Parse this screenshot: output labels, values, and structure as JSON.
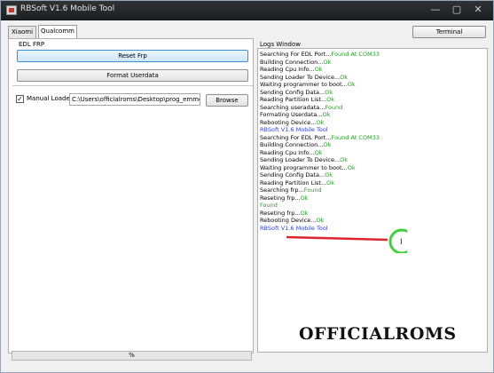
{
  "window": {
    "title": "RBSoft V1.6 Mobile Tool",
    "controls": {
      "minimize": "—",
      "maximize": "▢",
      "close": "✕"
    }
  },
  "tabs": [
    {
      "label": "Xiaomi",
      "selected": false
    },
    {
      "label": "Qualcomm",
      "selected": true
    }
  ],
  "terminal_label": "Terminal",
  "edl": {
    "group_label": "EDL FRP",
    "reset_label": "Reset Frp",
    "format_label": "Format Userdata"
  },
  "loader": {
    "checkbox_label": "Manual Loader",
    "checked": true,
    "path_value": "C:\\Users\\officialroms\\Desktop\\prog_emmc_fi",
    "browse_label": "Browse"
  },
  "logs": {
    "label": "Logs Window",
    "lines": [
      {
        "text": "Searching For EDL Port...",
        "suffix": "Found At COM33",
        "color": "green"
      },
      {
        "text": "Building Connection...",
        "suffix": "Ok",
        "color": "green"
      },
      {
        "text": "Reading Cpu Info...",
        "suffix": "Ok",
        "color": "green"
      },
      {
        "text": "Sending Loader To Device...",
        "suffix": "Ok",
        "color": "green"
      },
      {
        "text": "Waiting programmer to boot...",
        "suffix": "Ok",
        "color": "green"
      },
      {
        "text": "Sending Config Data...",
        "suffix": "Ok",
        "color": "green"
      },
      {
        "text": "Reading Partition List...",
        "suffix": "Ok",
        "color": "green"
      },
      {
        "text": "Searching useradata...",
        "suffix": "Found",
        "color": "green"
      },
      {
        "text": "Formating Userdata...",
        "suffix": "Ok",
        "color": "green"
      },
      {
        "text": "Rebooting Device...",
        "suffix": "Ok",
        "color": "green"
      },
      {
        "text": "RBSoft V1.6 Mobile Tool",
        "suffix": "",
        "color": "blue"
      },
      {
        "text": "Searching For EDL Port...",
        "suffix": "Found At COM33",
        "color": "green"
      },
      {
        "text": "Building Connection...",
        "suffix": "Ok",
        "color": "green"
      },
      {
        "text": "Reading Cpu Info...",
        "suffix": "Ok",
        "color": "green"
      },
      {
        "text": "Sending Loader To Device...",
        "suffix": "Ok",
        "color": "green"
      },
      {
        "text": "Waiting programmer to boot...",
        "suffix": "Ok",
        "color": "green"
      },
      {
        "text": "Sending Config Data...",
        "suffix": "Ok",
        "color": "green"
      },
      {
        "text": "Reading Partition List...",
        "suffix": "Ok",
        "color": "green"
      },
      {
        "text": "Searching frp...",
        "suffix": "Found",
        "color": "green"
      },
      {
        "text": "Reseting frp...",
        "suffix": "Ok",
        "color": "green"
      },
      {
        "text": "Found",
        "suffix": "",
        "color": "green"
      },
      {
        "text": "Reseting frp...",
        "suffix": "Ok",
        "color": "green"
      },
      {
        "text": "Rebooting Device...",
        "suffix": "Ok",
        "color": "green"
      },
      {
        "text": "RBSoft V1.6 Mobile Tool",
        "suffix": "",
        "color": "blue"
      }
    ]
  },
  "progress": {
    "label": "%",
    "value": 0
  },
  "watermark": "OFFICIALROMS",
  "colors": {
    "titlebar": "#2f3437",
    "log_ok": "#1e9e1e",
    "log_title": "#2b3fd6",
    "annotation_arrow": "#e0242c",
    "cursor_highlight": "#3fcf3f"
  }
}
